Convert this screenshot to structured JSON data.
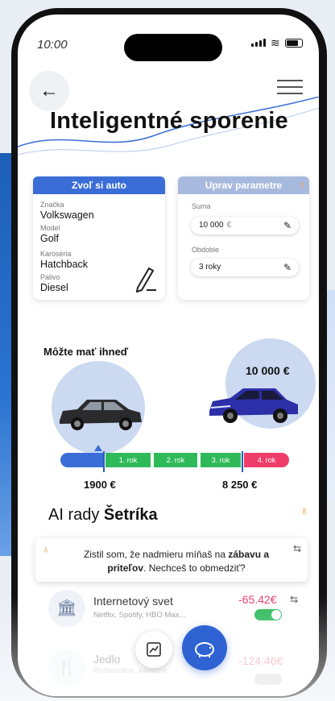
{
  "status": {
    "time": "10:00"
  },
  "header": {
    "title": "Inteligentné sporenie",
    "back_icon": "←"
  },
  "car_card": {
    "title": "Zvoľ si auto",
    "fields": [
      {
        "label": "Značka",
        "value": "Volkswagen"
      },
      {
        "label": "Model",
        "value": "Golf"
      },
      {
        "label": "Karoséria",
        "value": "Hatchback"
      },
      {
        "label": "Palivo",
        "value": "Diesel"
      }
    ]
  },
  "param_card": {
    "title": "Uprav parametre",
    "suma_label": "Suma",
    "suma_value": "10 000",
    "suma_currency": "€",
    "obdobie_label": "Obdobie",
    "obdobie_value": "3 roky"
  },
  "progress": {
    "available_label": "Môžte mať ihneď",
    "goal_amount": "10 000 €",
    "start_amount": "1900 €",
    "end_amount": "8 250 €",
    "segments": [
      "1. rok",
      "2. rok",
      "3. rok",
      "4. rok"
    ]
  },
  "ai": {
    "title_prefix": "AI rady ",
    "title_bold": "Šetríka",
    "tip_text_1": "Zistil som, že nadmieru míňaš na ",
    "tip_bold": "zábavu a priteľov",
    "tip_text_2": ". Nechceš to obmedziť?"
  },
  "expenses": [
    {
      "title": "Internetový svet",
      "sub": "Netflix, Spotify, HBO Max...",
      "amount": "-65.42€"
    },
    {
      "title": "Jedlo",
      "sub": "Reštaurácie, kaviarne",
      "amount": "-124.46€"
    }
  ],
  "colors": {
    "accent": "#3a6dd6",
    "green": "#2fba5a",
    "red": "#ef3d6a"
  }
}
